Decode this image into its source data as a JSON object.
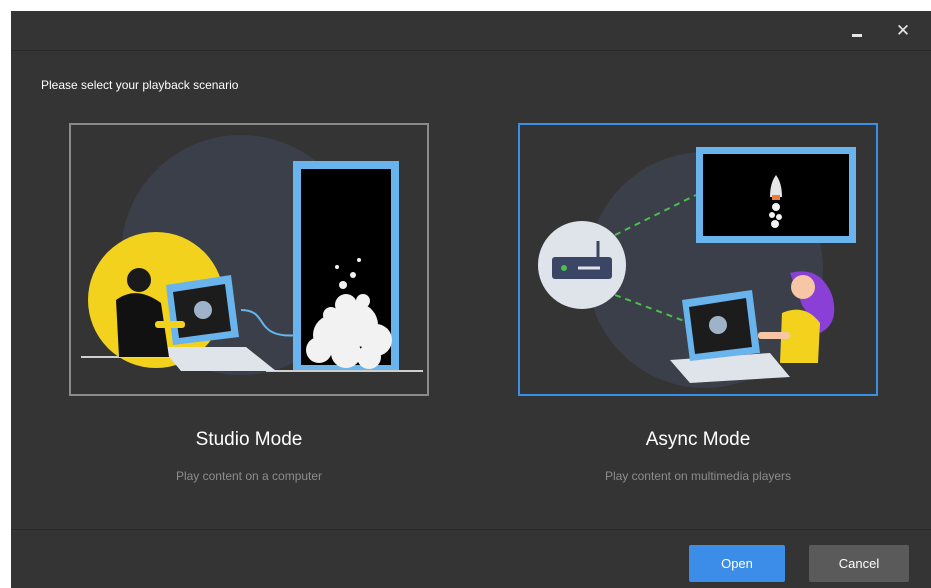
{
  "window": {
    "minimize_icon": "minimize-icon",
    "close_icon": "close-icon",
    "close_glyph": "✕"
  },
  "prompt": "Please select your playback scenario",
  "modes": [
    {
      "title": "Studio Mode",
      "description": "Play content on a computer",
      "selected": false
    },
    {
      "title": "Async Mode",
      "description": "Play content on multimedia players",
      "selected": true
    }
  ],
  "buttons": {
    "open": "Open",
    "cancel": "Cancel"
  },
  "colors": {
    "background": "#343434",
    "accent": "#3c8de8",
    "selected_border": "#3a8fe6",
    "unselected_border": "#8a8a8a",
    "cancel_bg": "#5a5a5a",
    "illustration_circle": "#3b3f4a",
    "yellow": "#f2d21c",
    "screen_border": "#6ab4ee"
  }
}
